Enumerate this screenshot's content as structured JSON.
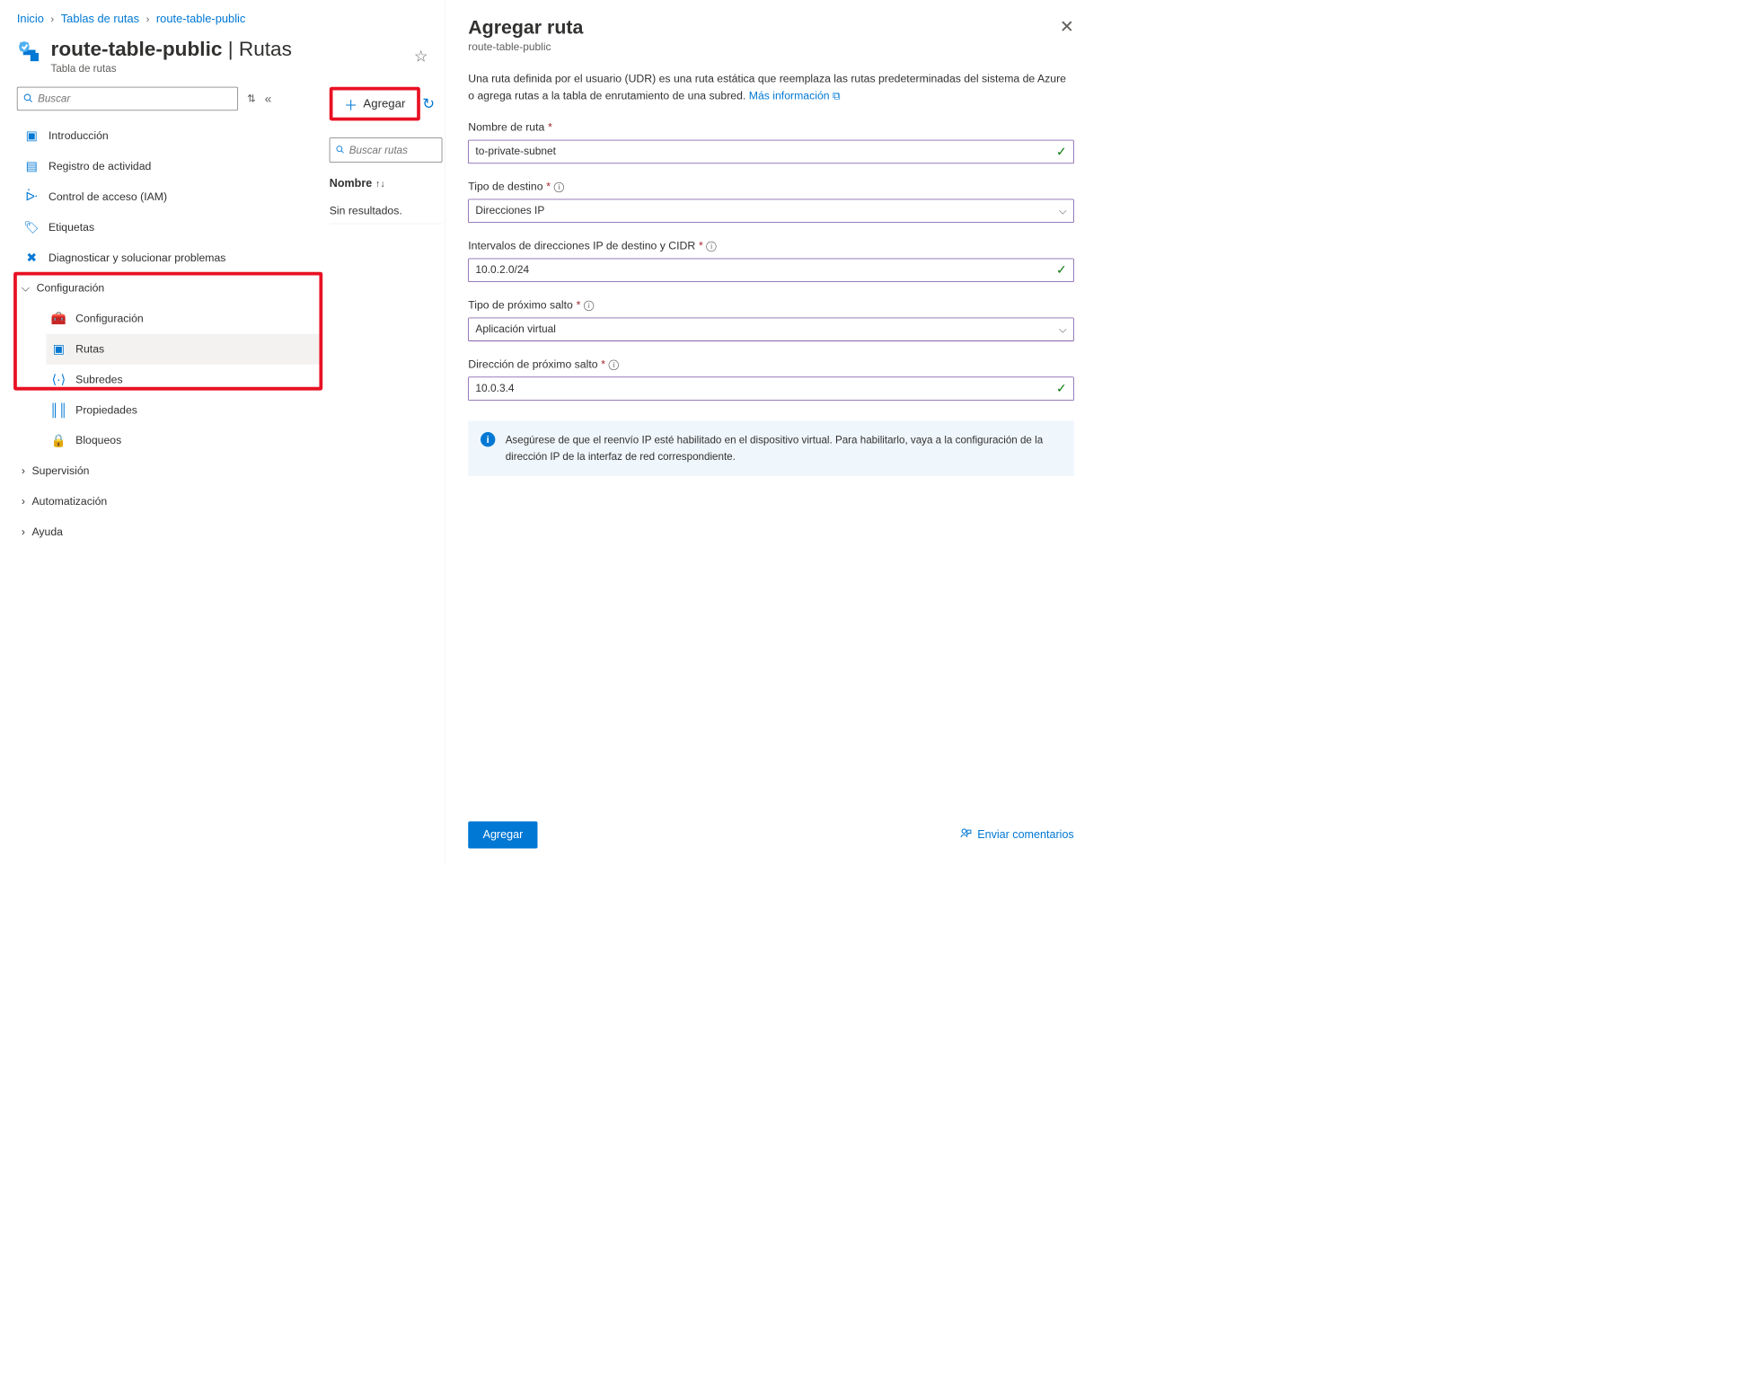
{
  "breadcrumbs": {
    "home": "Inicio",
    "tables": "Tablas de rutas",
    "current": "route-table-public"
  },
  "header": {
    "name": "route-table-public",
    "section": "Rutas",
    "subtitle": "Tabla de rutas"
  },
  "sidebar": {
    "search_placeholder": "Buscar",
    "items": {
      "intro": "Introducción",
      "activity": "Registro de actividad",
      "iam": "Control de acceso (IAM)",
      "tags": "Etiquetas",
      "diagnose": "Diagnosticar y solucionar problemas"
    },
    "groups": {
      "config": "Configuración",
      "config_sub": "Configuración",
      "routes": "Rutas",
      "subnets": "Subredes",
      "properties": "Propiedades",
      "locks": "Bloqueos",
      "supervision": "Supervisión",
      "automation": "Automatización",
      "help": "Ayuda"
    }
  },
  "toolbar": {
    "add": "Agregar",
    "search_routes_placeholder": "Buscar rutas"
  },
  "table": {
    "col_name": "Nombre",
    "empty": "Sin resultados."
  },
  "panel": {
    "title": "Agregar ruta",
    "subtitle": "route-table-public",
    "description": "Una ruta definida por el usuario (UDR) es una ruta estática que reemplaza las rutas predeterminadas del sistema de Azure o agrega rutas a la tabla de enrutamiento de una subred.",
    "learn_more": "Más información",
    "fields": {
      "name": {
        "label": "Nombre de ruta",
        "value": "to-private-subnet"
      },
      "dest_type": {
        "label": "Tipo de destino",
        "value": "Direcciones IP"
      },
      "cidr": {
        "label": "Intervalos de direcciones IP de destino y CIDR",
        "value": "10.0.2.0/24"
      },
      "hop_type": {
        "label": "Tipo de próximo salto",
        "value": "Aplicación virtual"
      },
      "hop_addr": {
        "label": "Dirección de próximo salto",
        "value": "10.0.3.4"
      }
    },
    "info": "Asegúrese de que el reenvío IP esté habilitado en el dispositivo virtual. Para habilitarlo, vaya a la configuración de la dirección IP de la interfaz de red correspondiente.",
    "submit": "Agregar",
    "feedback": "Enviar comentarios"
  }
}
